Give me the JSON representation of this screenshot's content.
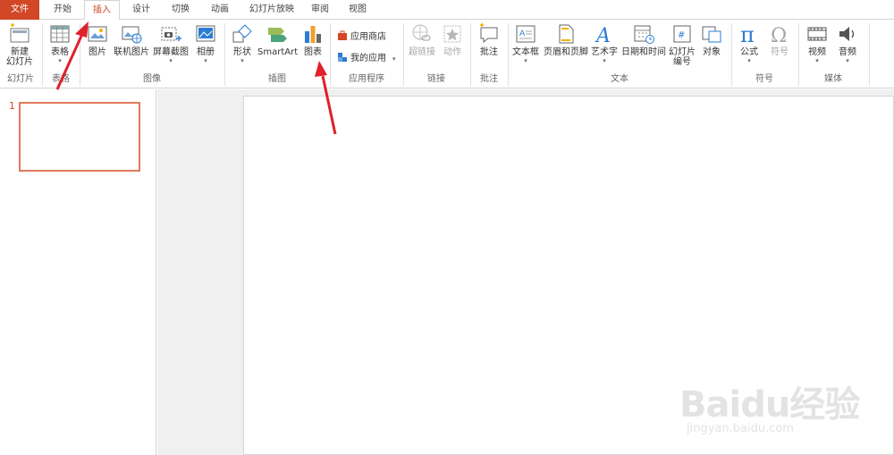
{
  "tabs": [
    {
      "label": "文件"
    },
    {
      "label": "开始"
    },
    {
      "label": "插入"
    },
    {
      "label": "设计"
    },
    {
      "label": "切换"
    },
    {
      "label": "动画"
    },
    {
      "label": "幻灯片放映"
    },
    {
      "label": "审阅"
    },
    {
      "label": "视图"
    }
  ],
  "ribbon": {
    "new_slide": "新建\n幻灯片",
    "table": "表格",
    "picture": "图片",
    "online_picture": "联机图片",
    "screenshot": "屏幕截图",
    "album": "相册",
    "shape": "形状",
    "smartart": "SmartArt",
    "chart": "图表",
    "app_store": "应用商店",
    "my_apps": "我的应用",
    "hyperlink": "超链接",
    "action": "动作",
    "comment": "批注",
    "textbox": "文本框",
    "header_footer": "页眉和页脚",
    "wordart": "艺术字",
    "datetime": "日期和时间",
    "slide_number": "幻灯片\n编号",
    "object": "对象",
    "equation": "公式",
    "symbol": "符号",
    "video": "视频",
    "audio": "音频",
    "groups": {
      "slides": "幻灯片",
      "tables": "表格",
      "images": "图像",
      "illustrations": "插图",
      "apps": "应用程序",
      "links": "链接",
      "comments": "批注",
      "text": "文本",
      "symbols": "符号",
      "media": "媒体"
    }
  },
  "thumbnails": {
    "slide_number": "1"
  },
  "watermark": {
    "text": "Baidu经验",
    "sub": "jingyan.baidu.com"
  },
  "colors": {
    "accent": "#d24726",
    "arrow": "#e0202a"
  }
}
